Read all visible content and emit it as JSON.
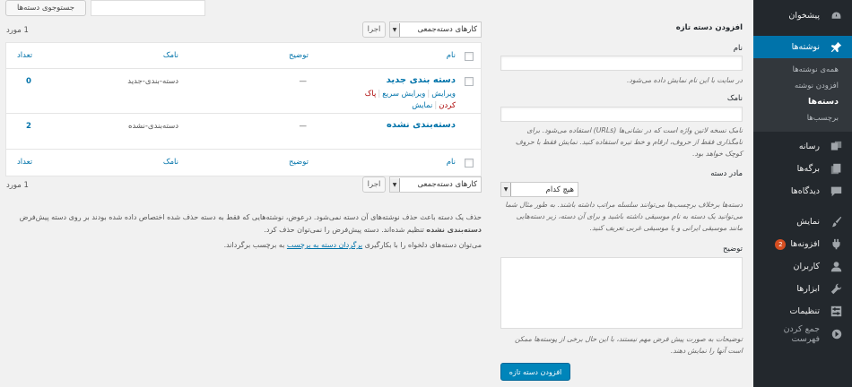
{
  "sidebar": {
    "items": [
      {
        "label": "پیشخوان",
        "icon": "dashboard-icon"
      },
      {
        "label": "نوشته‌ها",
        "icon": "pin-icon"
      },
      {
        "label": "رسانه",
        "icon": "media-icon"
      },
      {
        "label": "برگه‌ها",
        "icon": "pages-icon"
      },
      {
        "label": "دیدگاه‌ها",
        "icon": "comments-icon"
      },
      {
        "label": "نمایش",
        "icon": "appearance-icon"
      },
      {
        "label": "افزونه‌ها",
        "icon": "plugins-icon",
        "badge": "2"
      },
      {
        "label": "کاربران",
        "icon": "users-icon"
      },
      {
        "label": "ابزارها",
        "icon": "tools-icon"
      },
      {
        "label": "تنظیمات",
        "icon": "settings-icon"
      },
      {
        "label": "جمع کردن فهرست",
        "icon": "collapse-icon"
      }
    ],
    "submenu": [
      "همه‌ی نوشته‌ها",
      "افزودن نوشته",
      "دسته‌ها",
      "برچسب‌ها"
    ]
  },
  "add_form": {
    "title": "افزودن دسته تازه",
    "name_label": "نام",
    "name_help": "در سایت با این نام نمایش داده می‌شود.",
    "slug_label": "نامک",
    "slug_help": "نامک نسخه لاتین واژه است که در نشانی‌ها (URLs) استفاده می‌شود. برای نامگذاری فقط از حروف، ارقام و خط تیره استفاده کنید. نمایش فقط با حروف کوچک خواهد بود.",
    "parent_label": "مادر دسته",
    "parent_value": "هیچ کدام",
    "parent_help": "دسته‌ها برخلاف برچسب‌ها می‌توانند سلسله مراتب داشته باشند. به طور مثال شما می‌توانید یک دسته به نام موسیقی داشته باشید و برای آن دسته، زیر دسته‌هایی مانند موسیقی ایرانی و یا موسیقی غربی تعریف کنید.",
    "desc_label": "توضیح",
    "desc_help": "توضیحات به صورت پیش فرض مهم نیستند، با این حال برخی از پوسته‌ها ممکن است آنها را نمایش دهند.",
    "submit": "افزودن دسته تازه"
  },
  "search": {
    "button": "جستوجوی دسته‌ها",
    "value": ""
  },
  "bulk": {
    "label": "کارهای دسته‌جمعی",
    "apply": "اجرا"
  },
  "items_count": "1 مورد",
  "table": {
    "columns": {
      "name": "نام",
      "description": "توضیح",
      "slug": "نامک",
      "count": "تعداد"
    },
    "rows": [
      {
        "name": "دسته بندی جدید",
        "description": "—",
        "slug": "دسته-بندی-جدید",
        "count": "0",
        "actions": {
          "edit": "ویرایش",
          "quick_edit": "ویرایش سریع",
          "delete": "پاک کردن",
          "view": "نمایش"
        }
      },
      {
        "name": "دسته‌بندی نشده",
        "description": "—",
        "slug": "دسته‌بندی-نشده",
        "count": "2"
      }
    ]
  },
  "notes": {
    "line1": "حذف یک دسته باعث حذف نوشته‌های آن دسته نمی‌شود. درعوض، نوشته‌هایی که فقط به دسته حذف شده اختصاص داده شده بودند بر روی دسته پیش‌فرض",
    "line1_bold": "دسته‌بندی نشده",
    "line1_end": "تنظیم شده‌اند. دسته پیش‌فرض را نمی‌توان حذف کرد.",
    "line2_start": "می‌توان دسته‌های دلخواه را با بکارگیری",
    "line2_link": "برگردان دسته به برچسب",
    "line2_end": "به برچسب برگرداند."
  }
}
